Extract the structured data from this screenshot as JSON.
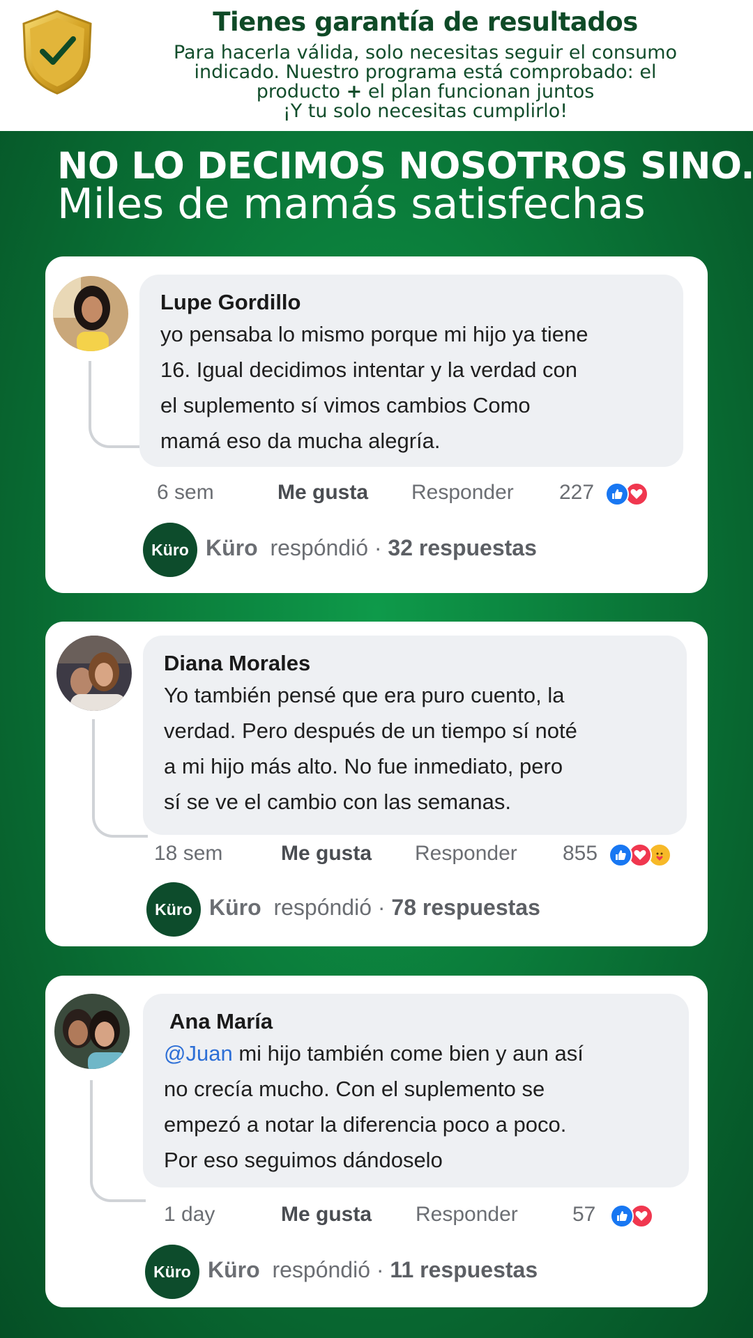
{
  "header": {
    "title": "Tienes garantía de resultados",
    "body_line1": "Para hacerla válida, solo necesitas seguir el consumo",
    "body_line2": "indicado. Nuestro programa está comprobado: el",
    "body_line3_a": "producto",
    "body_line3_plus": "+",
    "body_line3_b": "el plan funcionan juntos",
    "body_line4": "¡Y tu solo necesitas cumplirlo!",
    "shield_icon": "shield-check-icon"
  },
  "headline": {
    "line1": "NO LO DECIMOS NOSOTROS SINO...",
    "line2": "Miles de mamás satisfechas"
  },
  "colors": {
    "brand_green": "#0b7d3b",
    "dark_green": "#0d4c2c",
    "like_blue": "#1877f2",
    "love_red": "#f0374f",
    "mention_blue": "#2d6fd6"
  },
  "comments": [
    {
      "author": "Lupe Gordillo",
      "lines": [
        "yo pensaba lo mismo porque mi hijo ya tiene",
        "16. Igual decidimos intentar y la verdad con",
        "el suplemento sí vimos cambios Como",
        "mamá eso da mucha alegría."
      ],
      "time": "6 sem",
      "like": "Me gusta",
      "reply": "Responder",
      "reaction_count": "227",
      "reply_brand": "Küro",
      "reply_verb": "respóndió",
      "reply_sep": "·",
      "reply_count": "32 respuestas"
    },
    {
      "author": "Diana Morales",
      "lines": [
        "Yo también pensé que era puro cuento, la",
        "verdad. Pero después de un tiempo sí noté",
        "a mi hijo más alto. No fue inmediato, pero",
        "sí se ve el cambio con las semanas."
      ],
      "time": "18 sem",
      "like": "Me gusta",
      "reply": "Responder",
      "reaction_count": "855",
      "reply_brand": "Küro",
      "reply_verb": "respóndió",
      "reply_sep": "·",
      "reply_count": "78 respuestas"
    },
    {
      "author": "Ana María",
      "mention": "@Juan",
      "line1_rest": " mi hijo también come bien y aun así",
      "lines": [
        "no crecía mucho. Con el suplemento se",
        "empezó a notar la diferencia poco a poco.",
        "Por eso seguimos dándoselo"
      ],
      "time": "1 day",
      "like": "Me gusta",
      "reply": "Responder",
      "reaction_count": "57",
      "reply_brand": "Küro",
      "reply_verb": "respóndió",
      "reply_sep": "·",
      "reply_count": "11 respuestas"
    }
  ],
  "kuro_logo_text": "Küro"
}
